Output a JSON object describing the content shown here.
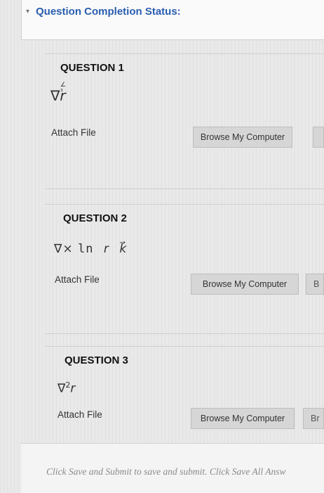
{
  "status": {
    "title": "Question Completion Status:"
  },
  "questions": [
    {
      "title": "QUESTION 1",
      "expression": {
        "nabla": "∇",
        "mark": "∠ ³",
        "var": "r"
      },
      "attach_label": "Attach File",
      "browse_label": "Browse My Computer"
    },
    {
      "title": "QUESTION 2",
      "expression": {
        "nabla": "∇×",
        "fn": "ln",
        "var": "r",
        "unit": "k⃗"
      },
      "attach_label": "Attach File",
      "browse_label": "Browse My Computer",
      "browse2_partial": "B"
    },
    {
      "title": "QUESTION 3",
      "expression": {
        "nabla": "∇",
        "sup": "2",
        "var": "r"
      },
      "attach_label": "Attach File",
      "browse_label": "Browse My Computer",
      "browse2_partial": "Br"
    }
  ],
  "footer": {
    "text": "Click Save and Submit to save and submit. Click Save All Answ"
  }
}
